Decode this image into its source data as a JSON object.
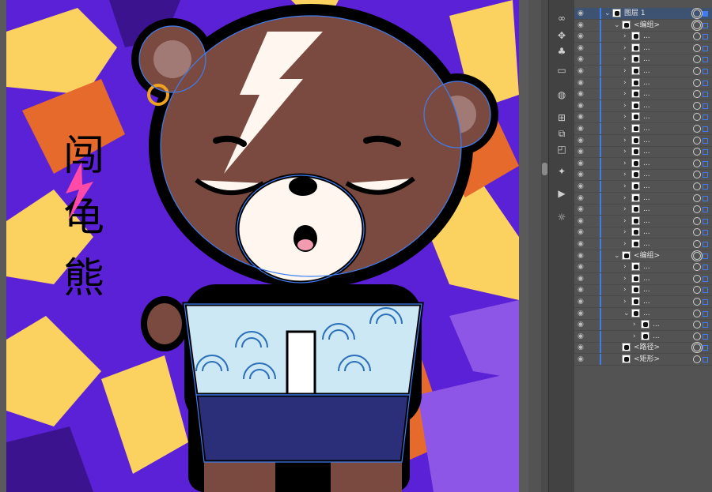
{
  "artwork": {
    "title_glyphs": "闯龟熊",
    "colors": {
      "purple": "#5b21d6",
      "yellow": "#fbd25f",
      "orange": "#e56a2c",
      "bear_brown": "#7a4a40",
      "muzzle": "#fff6ef",
      "shorts": "#2b2f7a",
      "path_highlight": "#3f7df0"
    }
  },
  "layers_panel": {
    "top_layer": {
      "name": "图层 1"
    },
    "rows": [
      {
        "kind": "layer",
        "name": "图层 1",
        "indent": 0,
        "expanded": true
      },
      {
        "kind": "group",
        "name": "<编组>",
        "indent": 1,
        "expanded": true
      },
      {
        "kind": "item",
        "name": "...",
        "indent": 2
      },
      {
        "kind": "item",
        "name": "...",
        "indent": 2
      },
      {
        "kind": "item",
        "name": "...",
        "indent": 2
      },
      {
        "kind": "item",
        "name": "...",
        "indent": 2
      },
      {
        "kind": "item",
        "name": "...",
        "indent": 2
      },
      {
        "kind": "item",
        "name": "...",
        "indent": 2
      },
      {
        "kind": "item",
        "name": "...",
        "indent": 2
      },
      {
        "kind": "item",
        "name": "...",
        "indent": 2
      },
      {
        "kind": "item",
        "name": "...",
        "indent": 2
      },
      {
        "kind": "item",
        "name": "...",
        "indent": 2
      },
      {
        "kind": "item",
        "name": "...",
        "indent": 2
      },
      {
        "kind": "item",
        "name": "...",
        "indent": 2
      },
      {
        "kind": "item",
        "name": "...",
        "indent": 2
      },
      {
        "kind": "item",
        "name": "...",
        "indent": 2
      },
      {
        "kind": "item",
        "name": "...",
        "indent": 2
      },
      {
        "kind": "item",
        "name": "...",
        "indent": 2
      },
      {
        "kind": "item",
        "name": "...",
        "indent": 2
      },
      {
        "kind": "item",
        "name": "...",
        "indent": 2
      },
      {
        "kind": "item",
        "name": "...",
        "indent": 2
      },
      {
        "kind": "group",
        "name": "<编组>",
        "indent": 1,
        "expanded": true
      },
      {
        "kind": "item",
        "name": "...",
        "indent": 2
      },
      {
        "kind": "item",
        "name": "...",
        "indent": 2
      },
      {
        "kind": "item",
        "name": "...",
        "indent": 2
      },
      {
        "kind": "item",
        "name": "...",
        "indent": 2
      },
      {
        "kind": "item",
        "name": "...",
        "indent": 2,
        "expanded": true
      },
      {
        "kind": "item",
        "name": "...",
        "indent": 3
      },
      {
        "kind": "item",
        "name": "...",
        "indent": 3
      },
      {
        "kind": "path",
        "name": "<路径>",
        "indent": 1
      },
      {
        "kind": "rect",
        "name": "<矩形>",
        "indent": 1
      }
    ]
  },
  "tools": [
    "link-icon",
    "puppet-warp-icon",
    "symbol-icon",
    "gradient-icon",
    "globe-icon",
    "align-icon",
    "transform-icon",
    "pathfinder-icon",
    "magic-wand-icon",
    "play-icon",
    "sun-icon"
  ]
}
